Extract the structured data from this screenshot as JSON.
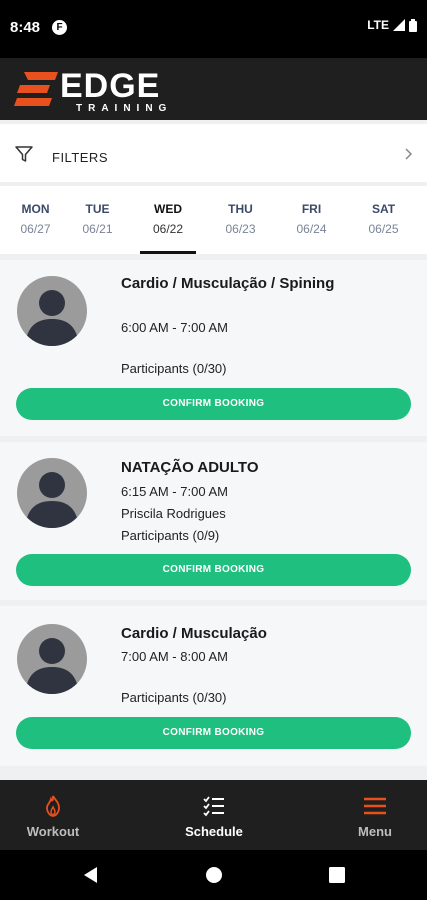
{
  "status": {
    "time": "8:48",
    "network": "LTE"
  },
  "header": {
    "logo_main": "EDGE",
    "logo_sub": "TRAINING",
    "accent": "#e8501e"
  },
  "filters": {
    "label": "FILTERS"
  },
  "days": [
    {
      "name": "MON",
      "date": "06/27"
    },
    {
      "name": "TUE",
      "date": "06/21"
    },
    {
      "name": "WED",
      "date": "06/22",
      "active": true
    },
    {
      "name": "THU",
      "date": "06/23"
    },
    {
      "name": "FRI",
      "date": "06/24"
    },
    {
      "name": "SAT",
      "date": "06/25"
    }
  ],
  "classes": [
    {
      "title": "Cardio / Musculação / Spining",
      "time": "6:00 AM - 7:00 AM",
      "instructor": "",
      "participants": "Participants (0/30)",
      "button": "CONFIRM BOOKING"
    },
    {
      "title": "NATAÇÃO ADULTO",
      "time": "6:15 AM - 7:00 AM",
      "instructor": "Priscila Rodrigues",
      "participants": "Participants (0/9)",
      "button": "CONFIRM BOOKING"
    },
    {
      "title": "Cardio / Musculação",
      "time": "7:00 AM - 8:00 AM",
      "instructor": "",
      "participants": "Participants (0/30)",
      "button": "CONFIRM BOOKING"
    }
  ],
  "tabs": [
    {
      "label": "Workout",
      "icon": "flame-icon"
    },
    {
      "label": "Schedule",
      "icon": "checklist-icon",
      "active": true
    },
    {
      "label": "Menu",
      "icon": "hamburger-icon"
    }
  ],
  "colors": {
    "button": "#1fbf7f",
    "header_bg": "#1f1f1f"
  }
}
